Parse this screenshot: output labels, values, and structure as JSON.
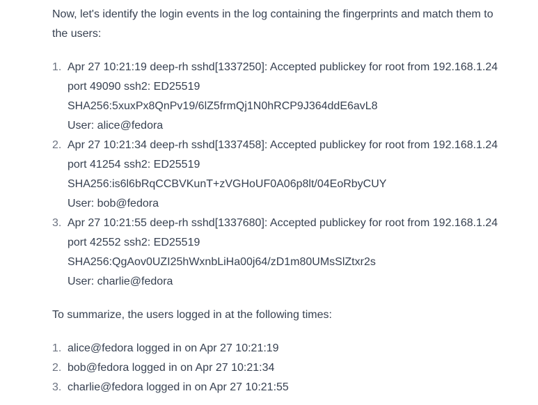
{
  "intro": "Now, let's identify the login events in the log containing the fingerprints and match them to the users:",
  "events": [
    {
      "num": "1.",
      "line1": "Apr 27 10:21:19 deep-rh sshd[1337250]: Accepted publickey for root from 192.168.1.24",
      "line2": "port 49090 ssh2: ED25519",
      "line3": "SHA256:5xuxPx8QnPv19/6lZ5frmQj1N0hRCP9J364ddE6avL8",
      "line4": "User: alice@fedora"
    },
    {
      "num": "2.",
      "line1": "Apr 27 10:21:34 deep-rh sshd[1337458]: Accepted publickey for root from 192.168.1.24",
      "line2": "port 41254 ssh2: ED25519",
      "line3": "SHA256:is6l6bRqCCBVKunT+zVGHoUF0A06p8lt/04EoRbyCUY",
      "line4": "User: bob@fedora"
    },
    {
      "num": "3.",
      "line1": "Apr 27 10:21:55 deep-rh sshd[1337680]: Accepted publickey for root from 192.168.1.24",
      "line2": "port 42552 ssh2: ED25519",
      "line3": "SHA256:QgAov0UZI25hWxnbLiHa00j64/zD1m80UMsSlZtxr2s",
      "line4": "User: charlie@fedora"
    }
  ],
  "summary_heading": "To summarize, the users logged in at the following times:",
  "summary": [
    {
      "num": "1.",
      "text": "alice@fedora logged in on Apr 27 10:21:19"
    },
    {
      "num": "2.",
      "text": "bob@fedora logged in on Apr 27 10:21:34"
    },
    {
      "num": "3.",
      "text": "charlie@fedora logged in on Apr 27 10:21:55"
    }
  ]
}
